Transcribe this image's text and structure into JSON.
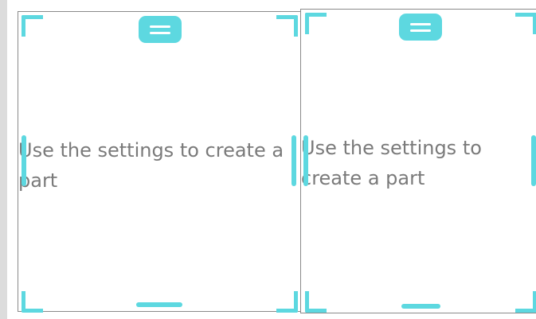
{
  "panels": [
    {
      "placeholder": "Use the settings to create a part"
    },
    {
      "placeholder": "Use the settings to create a part"
    }
  ],
  "icons": {
    "move": "drag-handle-icon",
    "resize_corner": "corner-resize-handle",
    "resize_edge": "edge-resize-handle"
  },
  "colors": {
    "handle": "#5dd8e0",
    "panel_border": "#8a8a8a",
    "placeholder_text": "#7a7a7a",
    "background": "#dcdcdc"
  }
}
